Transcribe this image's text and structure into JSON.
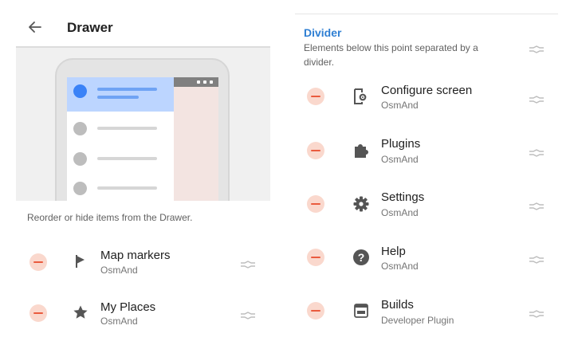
{
  "header": {
    "title": "Drawer"
  },
  "hint": "Reorder or hide items from the Drawer.",
  "left_items": [
    {
      "title": "Map markers",
      "subtitle": "OsmAnd",
      "icon": "flag-icon"
    },
    {
      "title": "My Places",
      "subtitle": "OsmAnd",
      "icon": "star-icon"
    }
  ],
  "divider": {
    "title": "Divider",
    "description": "Elements below this point separated by a divider."
  },
  "right_items": [
    {
      "title": "Configure screen",
      "subtitle": "OsmAnd",
      "icon": "configure-screen-icon"
    },
    {
      "title": "Plugins",
      "subtitle": "OsmAnd",
      "icon": "puzzle-icon"
    },
    {
      "title": "Settings",
      "subtitle": "OsmAnd",
      "icon": "gear-icon"
    },
    {
      "title": "Help",
      "subtitle": "OsmAnd",
      "icon": "help-icon"
    },
    {
      "title": "Builds",
      "subtitle": "Developer Plugin",
      "icon": "apk-icon"
    }
  ],
  "colors": {
    "accent_blue": "#2f7fd3",
    "remove_red": "#ea5b3e",
    "remove_bg": "#fad8cd",
    "icon_gray": "#555555"
  }
}
